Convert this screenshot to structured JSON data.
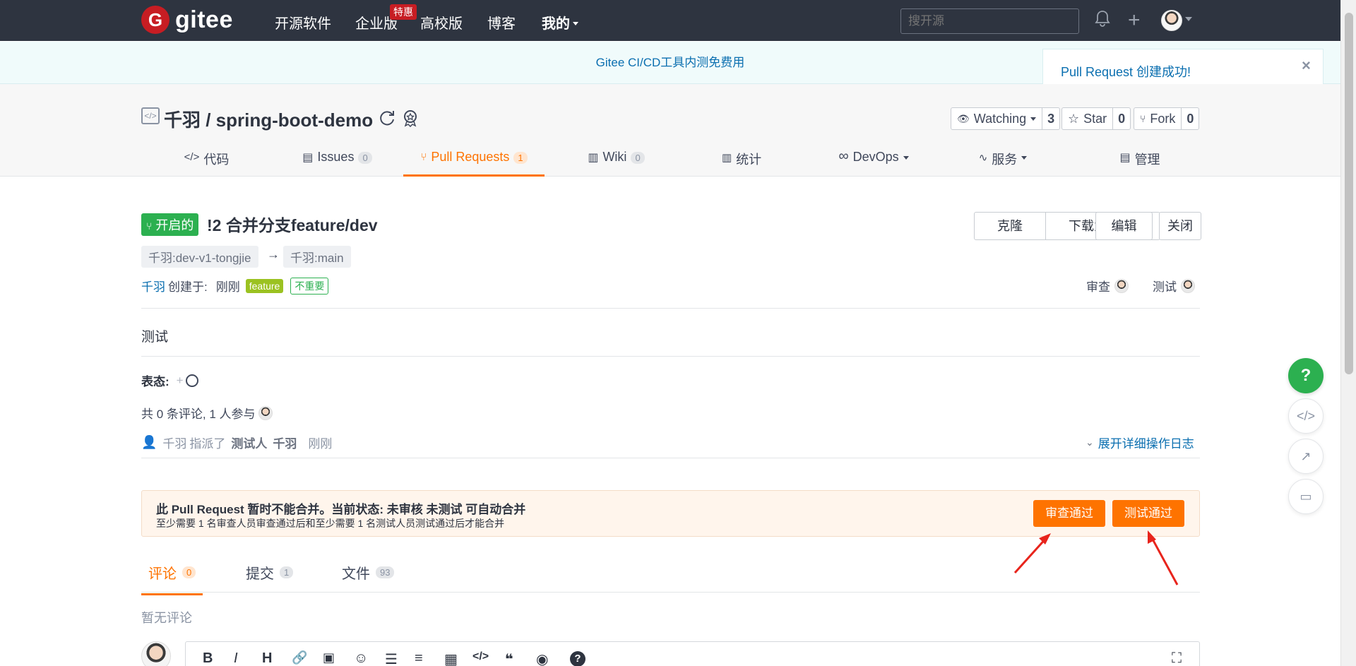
{
  "nav": {
    "logo_text": "gitee",
    "logo_letter": "G",
    "items": [
      {
        "label": "开源软件"
      },
      {
        "label": "企业版"
      },
      {
        "label": "高校版"
      },
      {
        "label": "博客"
      },
      {
        "label": "我的"
      }
    ],
    "hot_badge": "特惠",
    "search_placeholder": "搜开源"
  },
  "banner": {
    "text": "Gitee CI/CD工具内测免费用"
  },
  "toast": {
    "text": "Pull Request 创建成功!",
    "close": "×"
  },
  "repo": {
    "title": "千羽 / spring-boot-demo",
    "watching_label": "Watching",
    "watching_count": "3",
    "star_label": "Star",
    "star_count": "0",
    "fork_label": "Fork",
    "fork_count": "0"
  },
  "tabs": [
    {
      "label": "代码",
      "count": ""
    },
    {
      "label": "Issues",
      "count": "0"
    },
    {
      "label": "Pull Requests",
      "count": "1"
    },
    {
      "label": "Wiki",
      "count": "0"
    },
    {
      "label": "统计",
      "count": ""
    },
    {
      "label": "DevOps",
      "count": ""
    },
    {
      "label": "服务",
      "count": ""
    },
    {
      "label": "管理",
      "count": ""
    }
  ],
  "pr": {
    "status": "开启的",
    "title": "!2 合并分支feature/dev",
    "clone_label": "克隆",
    "download_label": "下载为",
    "edit_label": "编辑",
    "close_label": "关闭",
    "source_branch": "千羽:dev-v1-tongjie",
    "arrow": "→",
    "target_branch": "千羽:main",
    "author": "千羽",
    "created_label": "创建于:",
    "created_time": "刚刚",
    "label_feature": "feature",
    "label_minor": "不重要",
    "reviewer_label": "审查",
    "tester_label": "测试",
    "description": "测试",
    "reaction_label": "表态:",
    "reaction_plus": "+",
    "comment_summary": "共 0 条评论, 1 人参与",
    "assign_actor": "千羽",
    "assign_verb": "指派了",
    "assign_role": "测试人",
    "assign_target": "千羽",
    "assign_time": "刚刚",
    "expand_log": "展开详细操作日志"
  },
  "merge": {
    "title": "此 Pull Request 暂时不能合并。当前状态: 未审核 未测试 可自动合并",
    "subtitle": "至少需要 1 名审查人员审查通过后和至少需要 1 名测试人员测试通过后才能合并",
    "review_button": "审查通过",
    "test_button": "测试通过"
  },
  "lower_tabs": [
    {
      "label": "评论",
      "count": "0"
    },
    {
      "label": "提交",
      "count": "1"
    },
    {
      "label": "文件",
      "count": "93"
    }
  ],
  "no_comments": "暂无评论",
  "editor_tools": [
    "B",
    "I",
    "H",
    "🔗",
    "▣",
    "☺",
    "☰",
    "≡",
    "▦",
    "</>",
    "❝",
    "◉",
    "?",
    "⛶"
  ],
  "float": {
    "help": "?"
  },
  "colors": {
    "accent": "#fe7300",
    "nav_bg": "#2e3440",
    "open_green": "#2cb050",
    "link_blue": "#0b6fb0",
    "annotation_red": "#e8241c"
  }
}
